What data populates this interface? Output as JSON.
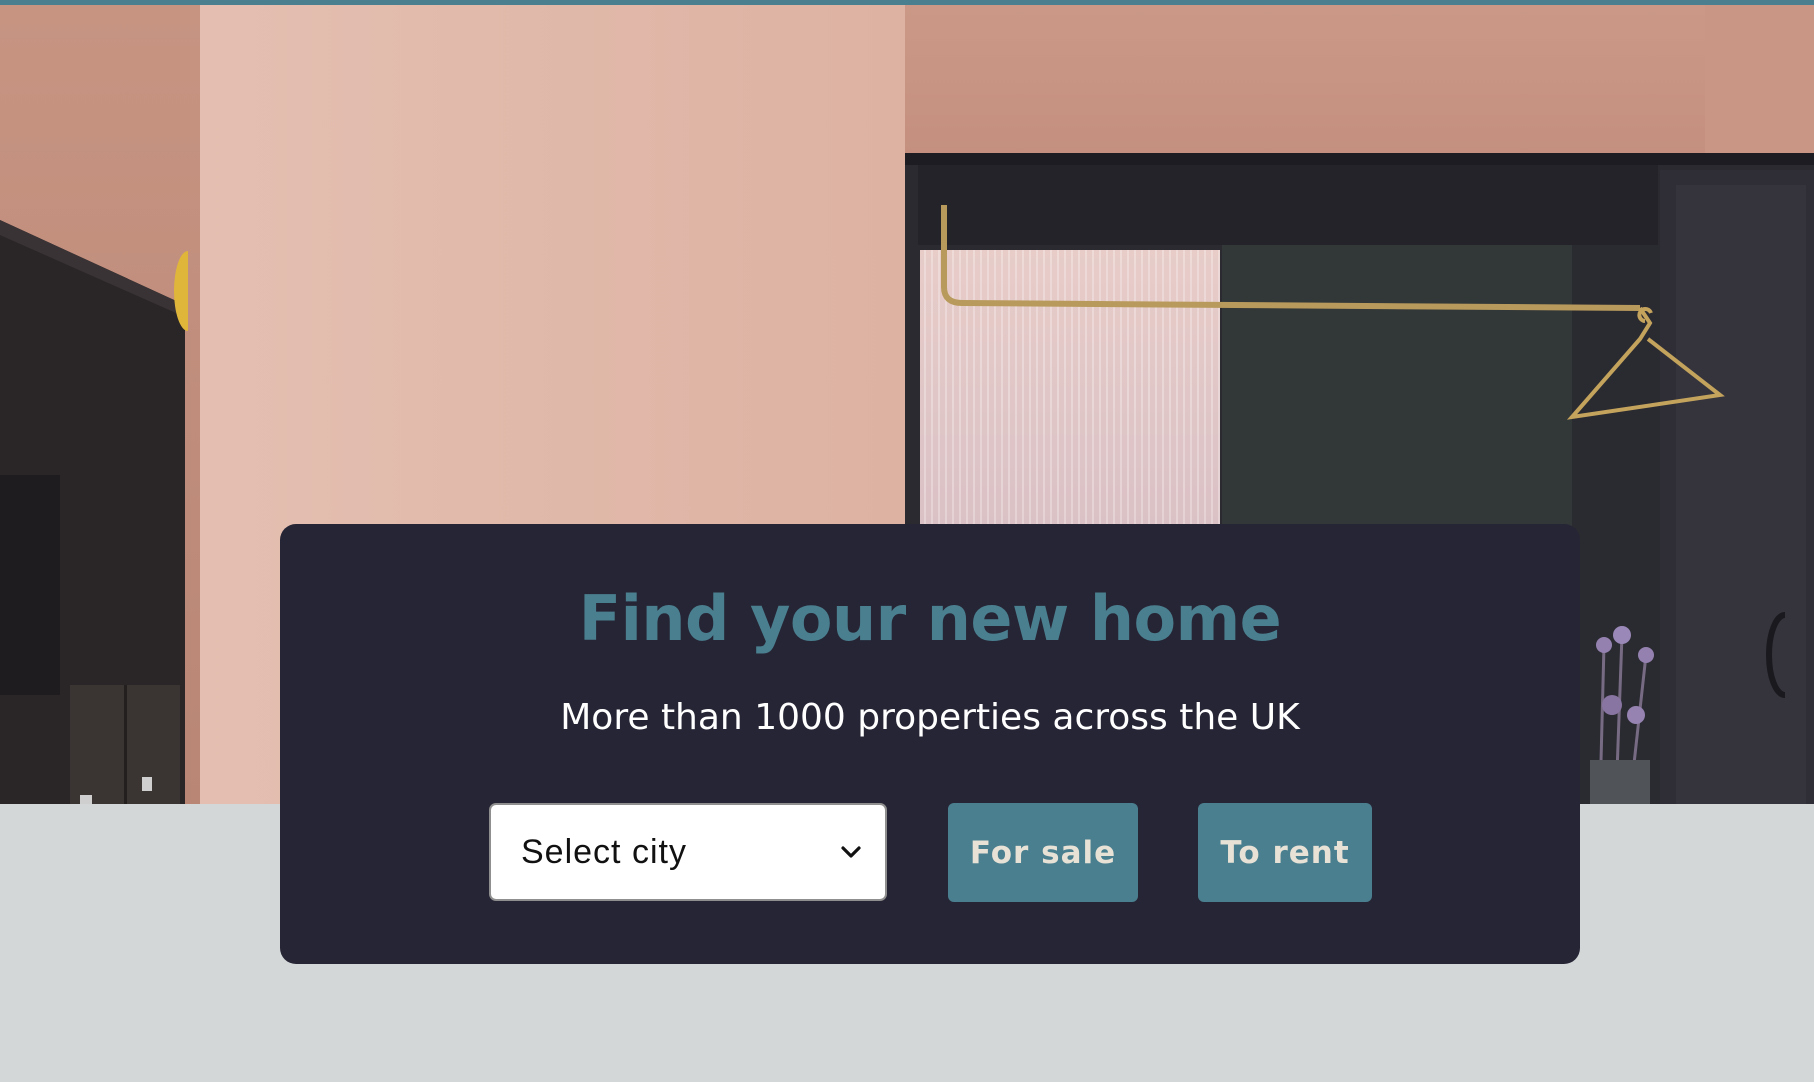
{
  "hero": {
    "image_alt": "Bedroom interior with pink walls and an open wardrobe rail"
  },
  "search": {
    "title": "Find your new home",
    "subtitle": "More than 1000 properties across the UK",
    "city_select": {
      "selected": "Select city",
      "icon": "chevron-down-icon"
    },
    "buttons": {
      "for_sale": "For sale",
      "to_rent": "To rent"
    }
  },
  "colors": {
    "accent": "#4a7f8f",
    "panel_background": "#262535",
    "page_background": "#d3d7d8",
    "button_text": "#e8e2d6"
  }
}
